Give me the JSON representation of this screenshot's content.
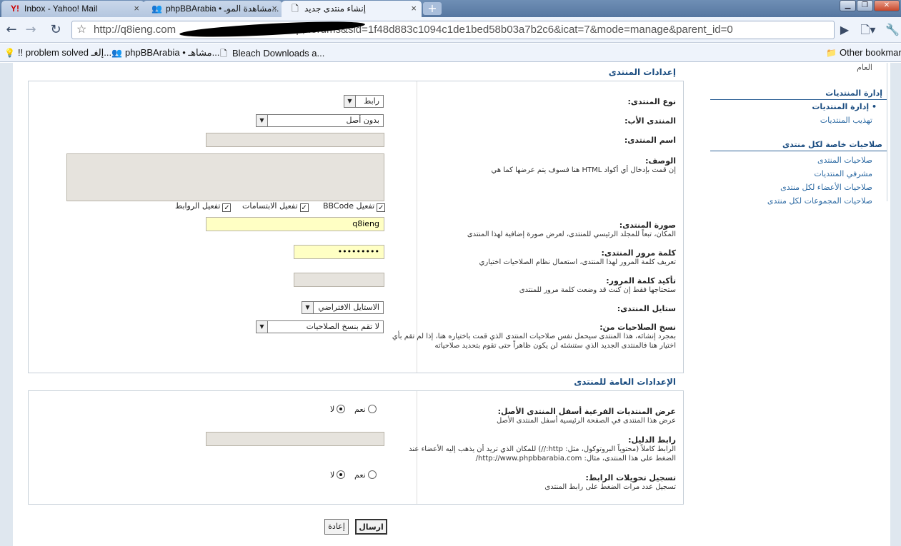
{
  "browser": {
    "tabs": [
      {
        "title": "Inbox - Yahoo! Mail",
        "icon": "yahoo-icon"
      },
      {
        "title": "phpBBArabia • مشاهدة الموـ...",
        "icon": "users-icon"
      },
      {
        "title": "إنشاء منتدى جديد",
        "icon": "page-icon"
      }
    ],
    "new_tab": "+",
    "url_prefix": "http://q8ieng.com",
    "url_suffix": "3p; forums&sid=1f48d883c1094c1de1bed58b03a7b2c6&icat=7&mode=manage&parent_id=0",
    "bookmarks": [
      {
        "label": "!! problem solved إلغـ...",
        "icon": "bulb-icon"
      },
      {
        "label": "phpBBArabia • مشاهـ...",
        "icon": "users-icon"
      },
      {
        "label": "Bleach Downloads a...",
        "icon": "page-icon"
      }
    ],
    "other_bookmarks": "Other bookmarks"
  },
  "sidebar": {
    "top_partial": "العام",
    "group1_title": "إدارة المنتديات",
    "group1_items": [
      {
        "label": "إدارة المنتديات",
        "current": true
      },
      {
        "label": "تهذيب المنتديات",
        "current": false
      }
    ],
    "group2_title": "صلاحيات خاصة لكل منتدى",
    "group2_items": [
      {
        "label": "صلاحيات المنتدى"
      },
      {
        "label": "مشرفي المنتديات"
      },
      {
        "label": "صلاحيات الأعضاء لكل منتدى"
      },
      {
        "label": "صلاحيات المجموعات لكل منتدى"
      }
    ]
  },
  "settings": {
    "title": "إعدادات المنتدى",
    "forum_type": {
      "label": "نوع المنتدى:",
      "value": "رابط"
    },
    "parent": {
      "label": "المنتدى الأب:",
      "value": "بدون أصل"
    },
    "name": {
      "label": "اسم المنتدى:",
      "value": ""
    },
    "description": {
      "label": "الوصف:",
      "help": "إن قمت بإدخال أي أكواد HTML هنا فسوف يتم عرضها كما هي"
    },
    "checkboxes": [
      {
        "label": "تفعيل BBCode",
        "checked": true
      },
      {
        "label": "تفعيل الابتسامات",
        "checked": true
      },
      {
        "label": "تفعيل الروابط",
        "checked": true
      }
    ],
    "image": {
      "label": "صورة المنتدى:",
      "help": "المكان، تبعاً للمجلد الرئيسي للمنتدى، لعرض صورة إضافية لهذا المنتدى",
      "value": "q8ieng"
    },
    "password": {
      "label": "كلمة مرور المنتدى:",
      "help": "تعريف كلمة المرور لهذا المنتدى، استعمال نظام الصلاحيات اختياري",
      "value": "•••••••••"
    },
    "confirm": {
      "label": "تأكيد كلمة المرور:",
      "help": "ستحتاجها فقط إن كنت قد وضعت كلمة مرور للمنتدى"
    },
    "style": {
      "label": "ستايل المنتدى:",
      "value": "الاستايل الافتراضي"
    },
    "copy_perms": {
      "label": "نسخ الصلاحيات من:",
      "help": "بمجرد إنشائه، هذا المنتدى سيحمل نفس صلاحيات المنتدى الذي قمت باختياره هنا، إذا لم تقم بأي اختيار هنا فالمنتدى الجديد الذي ستنشئه لن يكون ظاهراً حتى تقوم بتحديد صلاحياته",
      "value": "لا تقم بنسخ الصلاحيات"
    }
  },
  "general": {
    "title": "الإعدادات العامة للمنتدى",
    "show_sub": {
      "label": "عرض المنتديات الفرعية أسفل المنتدى الأصل:",
      "help": "عرض هذا المنتدى في الصفحة الرئيسية أسفل المنتدى الأصل",
      "yes": "نعم",
      "no": "لا"
    },
    "link": {
      "label": "رابط الدليل:",
      "help": "الرابط كاملاً (محتوياً البروتوكول، مثل: http://) للمكان الذي تريد أن يذهب إليه الأعضاء عند الضغط على هذا المنتدى، مثال: http://www.phpbbarabia.com/"
    },
    "track": {
      "label": "تسجيل تحويلات الرابط:",
      "help": "تسجيل عدد مرات الضغط على رابط المنتدى",
      "yes": "نعم",
      "no": "لا"
    }
  },
  "buttons": {
    "submit": "ارسال",
    "reset": "إعادة"
  }
}
